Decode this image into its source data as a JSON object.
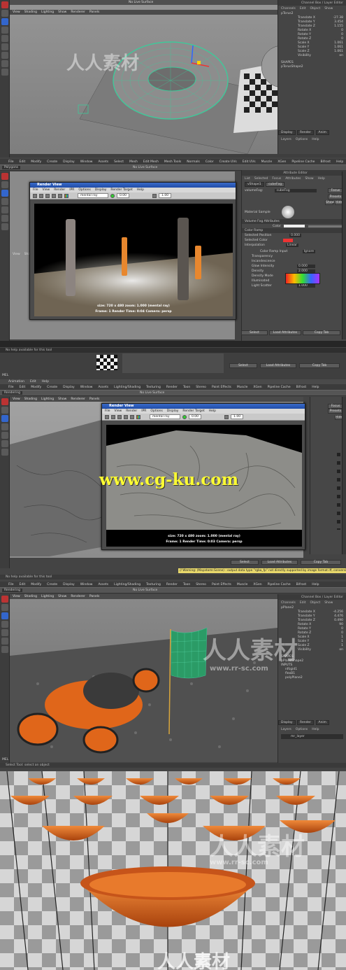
{
  "panel1": {
    "menu": [
      "View",
      "Shading",
      "Lighting",
      "Show",
      "Renderer",
      "Panels"
    ],
    "nocache": "No Live Surface",
    "channel_box_title": "Channel Box / Layer Editor",
    "channel_menu": [
      "Channels",
      "Edit",
      "Object",
      "Show"
    ],
    "object_name": "pTorus2",
    "attrs": [
      [
        "Translate X",
        "-27.38"
      ],
      [
        "Translate Y",
        "3.454"
      ],
      [
        "Translate Z",
        "1.155"
      ],
      [
        "Rotate X",
        "0"
      ],
      [
        "Rotate Y",
        "0"
      ],
      [
        "Rotate Z",
        "0"
      ],
      [
        "Scale X",
        "1.061"
      ],
      [
        "Scale Y",
        "1.061"
      ],
      [
        "Scale Z",
        "1.061"
      ],
      [
        "Visibility",
        "on"
      ]
    ],
    "shapes_label": "SHAPES",
    "shape_name": "pTorusShape2",
    "layer_tabs": [
      "Display",
      "Render",
      "Anim"
    ],
    "layer_menu": [
      "Layers",
      "Options",
      "Help"
    ]
  },
  "panel2": {
    "main_menu": [
      "File",
      "Edit",
      "Modify",
      "Create",
      "Display",
      "Window",
      "Assets",
      "Select",
      "Mesh",
      "Edit Mesh",
      "Mesh Tools",
      "Normals",
      "Color",
      "Create UVs",
      "Edit UVs",
      "Muscle",
      "XGen",
      "Pipeline Cache",
      "Bifrost",
      "Help"
    ],
    "mode": "Polygons",
    "nocache": "No Live Surface",
    "viewport_menu": [
      "View",
      "Shading"
    ],
    "render_view": {
      "title": "Render View",
      "menu": [
        "File",
        "View",
        "Render",
        "IPR",
        "Options",
        "Display",
        "Render Target",
        "Help"
      ],
      "renderer": "mental ray",
      "field1": "0.00",
      "field2": "1.00",
      "info_line1": "size: 720 x 480  zoom: 1.000      (mental ray)",
      "info_line2": "Frame: 1      Render Time: 0:04      Camera: persp"
    },
    "attr_editor_title": "Attribute Editor",
    "attr_tabs": [
      "vShape1",
      "cubeFog"
    ],
    "attr_menu": [
      "List",
      "Selected",
      "Focus",
      "Attributes",
      "Show",
      "Help"
    ],
    "volume_fog_label": "volumeFog:",
    "volume_fog_value": "cubeFog",
    "focus_label": "Focus",
    "presets_label": "Presets",
    "show_label": "Show",
    "hide_label": "Hide",
    "material_sample": "Material Sample",
    "section": "Volume Fog Attributes",
    "color_label": "Color",
    "ramp_section": "Color Ramp",
    "selected_position_label": "Selected Position",
    "selected_position": "0.000",
    "selected_color_label": "Selected Color",
    "interpolation_label": "Interpolation",
    "interpolation": "Linear",
    "color_ramp_input_label": "Color Ramp Input",
    "color_ramp_input": "Ignore",
    "rows": [
      [
        "Transparency",
        ""
      ],
      [
        "Incandescence",
        ""
      ],
      [
        "Glow Intensity",
        "0.000"
      ],
      [
        "Density",
        "2.000"
      ],
      [
        "Density Mode",
        "Object Space"
      ],
      [
        "Illuminated",
        "Illuminated"
      ],
      [
        "Light Scatter",
        "1.000"
      ]
    ],
    "select_btn": "Select",
    "load_attrs_btn": "Load Attributes",
    "copy_tab_btn": "Copy Tab"
  },
  "strip": {
    "help_text": "No help available for this tool",
    "select_btn": "Select",
    "load_attrs_btn": "Load Attributes",
    "copy_tab_btn": "Copy Tab",
    "mel": "MEL"
  },
  "panel3": {
    "top_menu": [
      "Animation",
      "Edit",
      "Help"
    ],
    "main_menu": [
      "File",
      "Edit",
      "Modify",
      "Create",
      "Display",
      "Window",
      "Assets",
      "Lighting/Shading",
      "Texturing",
      "Render",
      "Toon",
      "Stereo",
      "Paint Effects",
      "Muscle",
      "XGen",
      "Pipeline Cache",
      "Bifrost",
      "Help"
    ],
    "mode": "Rendering",
    "nocache": "No Live Surface",
    "viewport_menu": [
      "View",
      "Shading",
      "Lighting",
      "Show",
      "Renderer",
      "Panels"
    ],
    "render_view": {
      "title": "Render View",
      "menu": [
        "File",
        "View",
        "Render",
        "IPR",
        "Options",
        "Display",
        "Render Target",
        "Help"
      ],
      "renderer": "mental ray",
      "field1": "0.00",
      "field2": "1.00",
      "info_line1": "size: 720 x 480  zoom: 1.000      (mental ray)",
      "info_line2": "Frame: 1      Render Time: 0:03      Camera: persp"
    },
    "watermark": "www.cg-ku.com",
    "focus_label": "Focus",
    "presets_label": "Presets",
    "hide_label": "Hide",
    "select_btn": "Select",
    "load_attrs_btn": "Load Attributes",
    "copy_tab_btn": "Copy Tab",
    "warning": "// Warning: (Mayatomr.Scene) : output data type \"rgba_fp\" not directly supported by image format iff, conversion performed"
  },
  "panel4": {
    "help_text": "No help available for this tool",
    "main_menu": [
      "File",
      "Edit",
      "Modify",
      "Create",
      "Display",
      "Window",
      "Assets",
      "Lighting/Shading",
      "Texturing",
      "Render",
      "Toon",
      "Stereo",
      "Paint Effects",
      "Muscle",
      "XGen",
      "Pipeline Cache",
      "Bifrost",
      "Help"
    ],
    "mode": "Rendering",
    "nocache": "No Live Surface",
    "viewport_menu": [
      "View",
      "Shading",
      "Lighting",
      "Show",
      "Renderer",
      "Panels"
    ],
    "channel_box_title": "Channel Box / Layer Editor",
    "channel_menu": [
      "Channels",
      "Edit",
      "Object",
      "Show"
    ],
    "object_name": "pPlane2",
    "attrs": [
      [
        "Translate X",
        "-4.256"
      ],
      [
        "Translate Y",
        "4.476"
      ],
      [
        "Translate Z",
        "0.490"
      ],
      [
        "Rotate X",
        "90"
      ],
      [
        "Rotate Y",
        "0"
      ],
      [
        "Rotate Z",
        "0"
      ],
      [
        "Scale X",
        "1"
      ],
      [
        "Scale Y",
        "1"
      ],
      [
        "Scale Z",
        "1"
      ],
      [
        "Visibility",
        "on"
      ]
    ],
    "shapes_label": "SHAPES",
    "shape_name": "pPlaneShape2",
    "inputs_label": "INPUTS",
    "inputs": [
      "nRigid1",
      "flexB1",
      "polyPlane2"
    ],
    "layer_tabs": [
      "Display",
      "Render",
      "Anim"
    ],
    "layer_menu": [
      "Layers",
      "Options",
      "Help"
    ],
    "layer_item": "mr_layer",
    "status": "Select Tool: select an object",
    "mel": "MEL"
  },
  "watermarks": {
    "rr_cn": "人人素材",
    "rr_url": "www.rr-sc.com",
    "rr_bottom": "人人素材"
  },
  "colors": {
    "maya_bg": "#444444",
    "render_title": "#2b5cbd",
    "orange": "#e0661a",
    "fog_pillar": "#e8872e",
    "wire_green": "#3fc99a"
  }
}
